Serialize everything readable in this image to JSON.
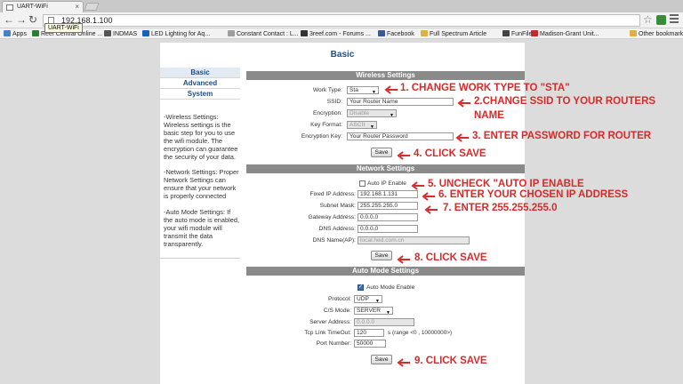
{
  "browser": {
    "tab_title": "UART-WiFi",
    "tab_close": "×",
    "tooltip": "UART-WiFi",
    "url": "192.168.1.100",
    "bookmarks": [
      {
        "label": "Apps",
        "icon": "apps-icon",
        "color": "#4a7fd0"
      },
      {
        "label": "Reef Central Online ...",
        "icon": "reef-icon",
        "color": "#2e7d32"
      },
      {
        "label": "INDMAS",
        "icon": "indmas-icon",
        "color": "#555555"
      },
      {
        "label": "LED Lighting for Aq...",
        "icon": "led-icon",
        "color": "#1565c0"
      },
      {
        "label": "Constant Contact : L...",
        "icon": "page-icon",
        "color": "#9e9e9e"
      },
      {
        "label": "3reef.com - Forums ...",
        "icon": "reef3-icon",
        "color": "#333333"
      },
      {
        "label": "Facebook",
        "icon": "facebook-icon",
        "color": "#3b5998"
      },
      {
        "label": "Full Spectrum Article",
        "icon": "folder-icon",
        "color": "#e0b040"
      },
      {
        "label": "FunFile",
        "icon": "funfile-icon",
        "color": "#444444"
      },
      {
        "label": "Madison-Grant Unit...",
        "icon": "madison-icon",
        "color": "#c62828"
      },
      {
        "label": "Other bookmarks",
        "icon": "folder-icon",
        "color": "#e0b040"
      }
    ]
  },
  "page": {
    "title": "Basic",
    "nav": [
      "Basic",
      "Advanced",
      "System"
    ],
    "help": [
      "-Wireless Settings: Wireless settings is the basic step for you to use the wifi module. The encryption can guarantee the security of your data.",
      "-Network Settings: Proper Network Settings can ensure that your network is properly connected",
      "-Auto Mode Settings: If the auto mode is enabled, your wifi module will transmit the data transparently."
    ],
    "wireless": {
      "header": "Wireless Settings",
      "work_type_label": "Work Type:",
      "work_type_value": "Sta",
      "ssid_label": "SSID:",
      "ssid_value": "Your Router Name",
      "encryption_label": "Encryption:",
      "encryption_value": "Disable",
      "key_format_label": "Key Format:",
      "key_format_value": "ASCII",
      "encryption_key_label": "Encryption Key:",
      "encryption_key_value": "Your Router Password",
      "save_label": "Save"
    },
    "network": {
      "header": "Network Settings",
      "auto_ip_label": "Auto IP Enable",
      "fixed_ip_label": "Fixed IP Address:",
      "fixed_ip_value": "192.168.1.131",
      "subnet_label": "Subnet Mask:",
      "subnet_value": "255.255.255.0",
      "gateway_label": "Gateway Address:",
      "gateway_value": "0.0.0.0",
      "dns_label": "DNS Address:",
      "dns_value": "0.0.0.0",
      "dns_name_label": "DNS Name(AP):",
      "dns_name_value": "local.hed.com.cn",
      "save_label": "Save"
    },
    "auto_mode": {
      "header": "Auto Mode Settings",
      "enable_label": "Auto Mode Enable",
      "protocol_label": "Protocol:",
      "protocol_value": "UDP",
      "cs_mode_label": "C/S Mode:",
      "cs_mode_value": "SERVER",
      "server_address_label": "Server Address:",
      "server_address_value": "0.0.0.0",
      "timeout_label": "Tcp Link TimeOut:",
      "timeout_value": "120",
      "timeout_hint": "s (range <0 , 10000000>)",
      "port_label": "Port Number:",
      "port_value": "50000",
      "save_label": "Save"
    }
  },
  "annotations": {
    "a1": "1. CHANGE WORK TYPE TO \"STA\"",
    "a2_line1": "2.CHANGE SSID TO YOUR ROUTERS",
    "a2_line2": "NAME",
    "a3": "3. ENTER PASSWORD FOR  ROUTER",
    "a4": "4. CLICK SAVE",
    "a5": "5. UNCHECK \"AUTO IP ENABLE",
    "a6": "6. ENTER YOUR CHOSEN IP ADDRESS",
    "a7": "7. ENTER 255.255.255.0",
    "a8": "8. CLICK SAVE",
    "a9": "9. CLICK SAVE",
    "color": "#d62b2b"
  }
}
